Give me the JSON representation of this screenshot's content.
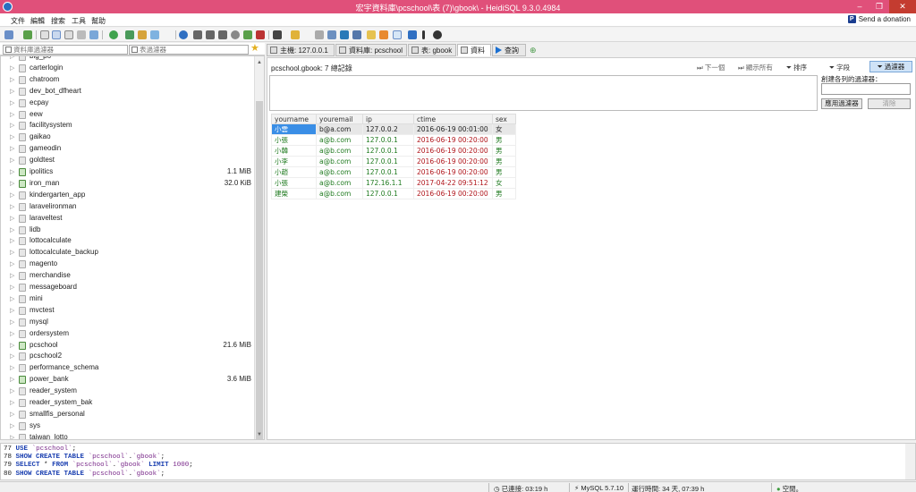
{
  "window": {
    "title": "宏宇資料庫\\pcschool\\表 (7)\\gbook\\ - HeidiSQL 9.3.0.4984",
    "minimize": "–",
    "restore": "❐",
    "close": "✕"
  },
  "menu": [
    "文件",
    "編輯",
    "搜索",
    "工具",
    "幫助"
  ],
  "donate_label": "Send a donation",
  "filters": {
    "db_filter_placeholder": "資料庫過濾器",
    "table_filter_placeholder": "表過濾器"
  },
  "tree": {
    "databases": [
      {
        "name": "big_po",
        "size": ""
      },
      {
        "name": "carterlogin",
        "size": ""
      },
      {
        "name": "chatroom",
        "size": ""
      },
      {
        "name": "dev_bot_dfheart",
        "size": ""
      },
      {
        "name": "ecpay",
        "size": ""
      },
      {
        "name": "eew",
        "size": ""
      },
      {
        "name": "facilitysystem",
        "size": ""
      },
      {
        "name": "gaikao",
        "size": ""
      },
      {
        "name": "gameodin",
        "size": ""
      },
      {
        "name": "goldtest",
        "size": ""
      },
      {
        "name": "ipolitics",
        "size": "1.1 MiB"
      },
      {
        "name": "iron_man",
        "size": "32.0 KiB"
      },
      {
        "name": "kindergarten_app",
        "size": ""
      },
      {
        "name": "laravelironman",
        "size": ""
      },
      {
        "name": "laraveltest",
        "size": ""
      },
      {
        "name": "lidb",
        "size": ""
      },
      {
        "name": "lottocalculate",
        "size": ""
      },
      {
        "name": "lottocalculate_backup",
        "size": ""
      },
      {
        "name": "magento",
        "size": ""
      },
      {
        "name": "merchandise",
        "size": ""
      },
      {
        "name": "messageboard",
        "size": ""
      },
      {
        "name": "mini",
        "size": ""
      },
      {
        "name": "mvctest",
        "size": ""
      },
      {
        "name": "mysql",
        "size": ""
      },
      {
        "name": "ordersystem",
        "size": ""
      },
      {
        "name": "pcschool",
        "size": "21.6 MiB"
      },
      {
        "name": "pcschool2",
        "size": ""
      },
      {
        "name": "performance_schema",
        "size": ""
      },
      {
        "name": "power_bank",
        "size": "3.6 MiB"
      },
      {
        "name": "reader_system",
        "size": ""
      },
      {
        "name": "reader_system_bak",
        "size": ""
      },
      {
        "name": "smallfis_personal",
        "size": ""
      },
      {
        "name": "sys",
        "size": ""
      },
      {
        "name": "taiwan_lotto",
        "size": ""
      }
    ]
  },
  "tabs": [
    {
      "label": "主機: 127.0.0.1"
    },
    {
      "label": "資料庫: pcschool"
    },
    {
      "label": "表: gbook"
    },
    {
      "label": "資料"
    },
    {
      "label": "查詢"
    }
  ],
  "data_pane": {
    "caption": "pcschool.gbook: 7 總記錄",
    "next_label": "下一個",
    "show_all_label": "顯示所有",
    "sort_label": "排序",
    "columns_label": "字段",
    "filter_label": "過濾器",
    "create_filter_label": "創建各列的過濾器：",
    "apply_filter_label": "應用過濾器",
    "clear_label": "清除"
  },
  "grid": {
    "columns": [
      "yourname",
      "youremail",
      "ip",
      "ctime",
      "sex"
    ],
    "rows": [
      [
        "小雲",
        "b@a.com",
        "127.0.0.2",
        "2016-06-19 00:01:00",
        "女"
      ],
      [
        "小張",
        "a@b.com",
        "127.0.0.1",
        "2016-06-19 00:20:00",
        "男"
      ],
      [
        "小韓",
        "a@b.com",
        "127.0.0.1",
        "2016-06-19 00:20:00",
        "男"
      ],
      [
        "小李",
        "a@b.com",
        "127.0.0.1",
        "2016-06-19 00:20:00",
        "男"
      ],
      [
        "小趙",
        "a@b.com",
        "127.0.0.1",
        "2016-06-19 00:20:00",
        "男"
      ],
      [
        "小張",
        "a@b.com",
        "172.16.1.1",
        "2017-04-22 09:51:12",
        "女"
      ],
      [
        "建榮",
        "a@b.com",
        "127.0.0.1",
        "2016-06-19 00:20:00",
        "男"
      ]
    ]
  },
  "sql_log": [
    {
      "num": "77",
      "parts": [
        [
          "kw",
          "USE"
        ],
        [
          "t",
          " "
        ],
        [
          "ident",
          "`pcschool`"
        ],
        [
          "t",
          ";"
        ]
      ]
    },
    {
      "num": "78",
      "parts": [
        [
          "kw",
          "SHOW CREATE TABLE"
        ],
        [
          "t",
          " "
        ],
        [
          "ident",
          "`pcschool`"
        ],
        [
          "t",
          "."
        ],
        [
          "ident",
          "`gbook`"
        ],
        [
          "t",
          ";"
        ]
      ]
    },
    {
      "num": "79",
      "parts": [
        [
          "kw",
          "SELECT"
        ],
        [
          "t",
          " * "
        ],
        [
          "kw",
          "FROM"
        ],
        [
          "t",
          " "
        ],
        [
          "ident",
          "`pcschool`"
        ],
        [
          "t",
          "."
        ],
        [
          "ident",
          "`gbook`"
        ],
        [
          "t",
          " "
        ],
        [
          "kw",
          "LIMIT"
        ],
        [
          "t",
          " "
        ],
        [
          "num",
          "1000"
        ],
        [
          "t",
          ";"
        ]
      ]
    },
    {
      "num": "80",
      "parts": [
        [
          "kw",
          "SHOW CREATE TABLE"
        ],
        [
          "t",
          " "
        ],
        [
          "ident",
          "`pcschool`"
        ],
        [
          "t",
          "."
        ],
        [
          "ident",
          "`gbook`"
        ],
        [
          "t",
          ";"
        ]
      ]
    }
  ],
  "status": {
    "connected": "已連接: 03:19 h",
    "server": "MySQL 5.7.10",
    "uptime": "運行時間: 34 天, 07:39 h",
    "idle": "空閒。"
  },
  "colors": {
    "titlebar": "#e0507a",
    "accent": "#3a8ee6"
  }
}
